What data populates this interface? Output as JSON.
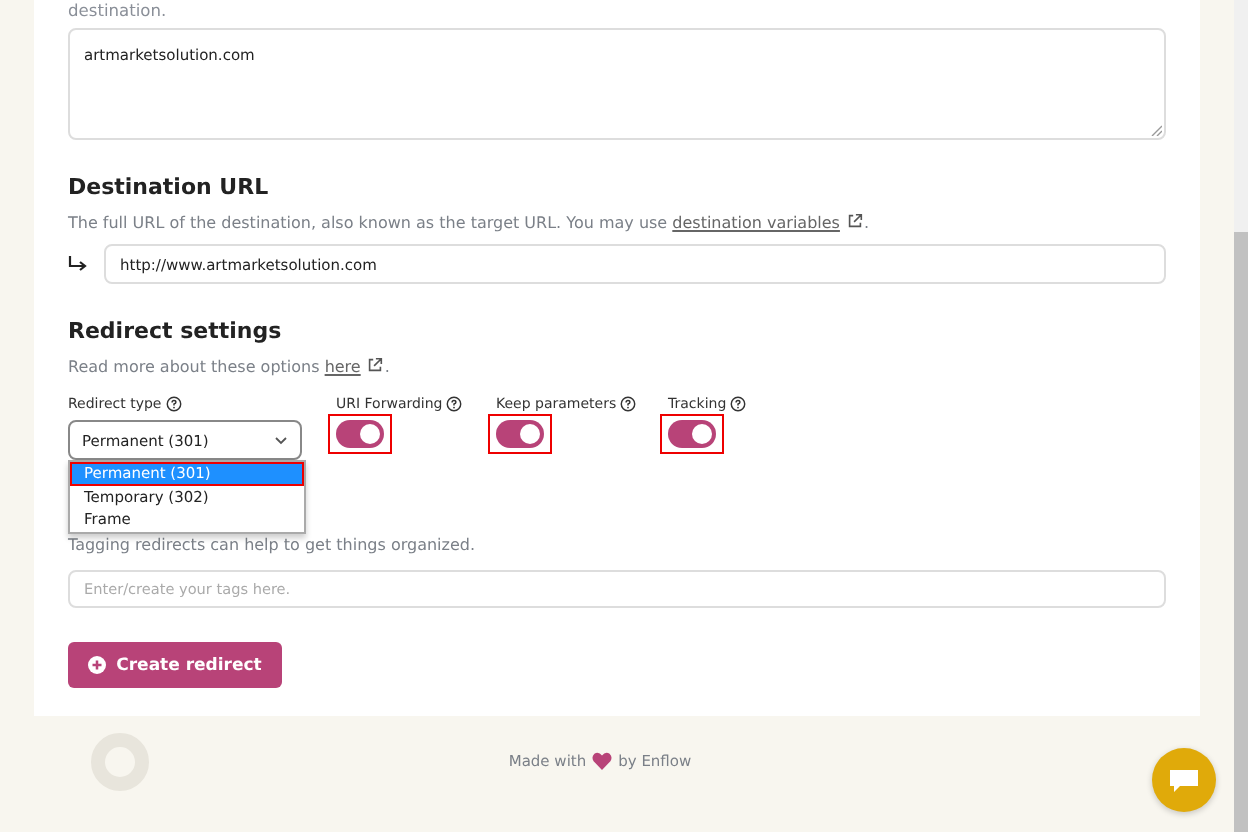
{
  "intro_text": "destination.",
  "source_field": {
    "value": "artmarketsolution.com"
  },
  "destination": {
    "heading": "Destination URL",
    "description_before": "The full URL of the destination, also known as the target URL. You may use ",
    "link": "destination variables",
    "description_after": ".",
    "value": "http://www.artmarketsolution.com"
  },
  "redirect_settings": {
    "heading": "Redirect settings",
    "description_before": "Read more about these options ",
    "link": "here",
    "description_after": ".",
    "redirect_type": {
      "label": "Redirect type",
      "value": "Permanent (301)",
      "expanded": true,
      "options": [
        {
          "label": "Permanent (301)",
          "selected": true
        },
        {
          "label": "Temporary (302)",
          "selected": false
        },
        {
          "label": "Frame",
          "selected": false
        }
      ]
    },
    "toggles": [
      {
        "label": "URI Forwarding",
        "on": true,
        "highlighted": true
      },
      {
        "label": "Keep parameters",
        "on": true,
        "highlighted": true
      },
      {
        "label": "Tracking",
        "on": true,
        "highlighted": true
      }
    ]
  },
  "tags": {
    "description": "Tagging redirects can help to get things organized.",
    "placeholder": "Enter/create your tags here."
  },
  "create_button": "Create redirect",
  "footer": {
    "before": "Made with",
    "after": "by Enflow"
  }
}
